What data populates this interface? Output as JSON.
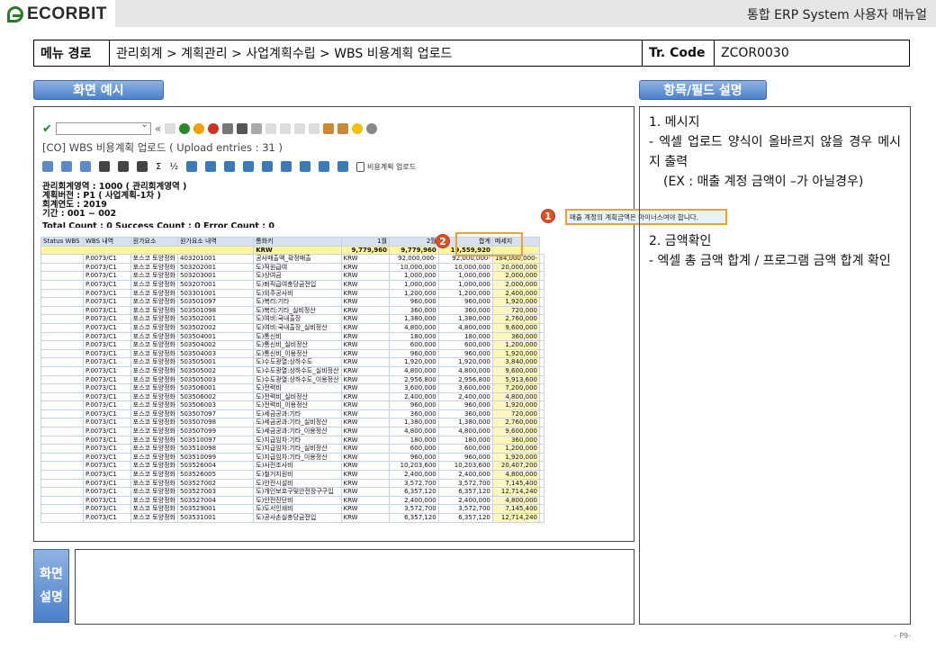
{
  "header": {
    "logo": "ECORBIT",
    "title": "통합 ERP System 사용자 매뉴얼"
  },
  "path": {
    "menu_label": "메뉴 경로",
    "menu_value": "관리회계 > 계획관리 > 사업계획수립 > WBS 비용계획 업로드",
    "tcode_label": "Tr. Code",
    "tcode_value": "ZCOR0030"
  },
  "sections": {
    "screen_example": "화면 예시",
    "field_desc": "항목/필드 설명",
    "screen_desc_1": "화면",
    "screen_desc_2": "설명"
  },
  "sap": {
    "title": "[CO] WBS 비용계획 업로드 ( Upload entries : 31 )",
    "toolbar_text": "비용계획 업로드",
    "info": [
      "관리회계영역 : 1000 (       관리회계영역 )",
      "계획버전 : P1 ( 사업계획-1차 )",
      "회계연도 : 2019",
      "기간 : 001 ~ 002"
    ],
    "count_line": "Total Count : 0 Success Count : 0 Error Count : 0",
    "message": "매출 계정의 계획금액은 마이너스여야 합니다."
  },
  "grid": {
    "headers": [
      "Status WBS",
      "WBS 내역",
      "원가요소",
      "원가요소 내역",
      "통화키",
      "1월",
      "2월",
      "합계",
      "메세지"
    ],
    "total": {
      "currency": "KRW",
      "m1": "9,779,960",
      "m2": "9,779,960",
      "sum": "19,559,920"
    },
    "rows": [
      [
        "P.0073/C1",
        "포스코 토양정화",
        "403201001",
        "공사매출액_확정매출",
        "KRW",
        "92,000,000-",
        "92,000,000-",
        "184,000,000-"
      ],
      [
        "P.0073/C1",
        "포스코 토양정화",
        "503202001",
        "도)직원급여",
        "KRW",
        "10,000,000",
        "10,000,000",
        "20,000,000"
      ],
      [
        "P.0073/C1",
        "포스코 토양정화",
        "503203001",
        "도)상여금",
        "KRW",
        "1,000,000",
        "1,000,000",
        "2,000,000"
      ],
      [
        "P.0073/C1",
        "포스코 토양정화",
        "503207001",
        "도)퇴직급여충당금전입",
        "KRW",
        "1,000,000",
        "1,000,000",
        "2,000,000"
      ],
      [
        "P.0073/C1",
        "포스코 토양정화",
        "503301001",
        "도)외주공사비",
        "KRW",
        "1,200,000",
        "1,200,000",
        "2,400,000"
      ],
      [
        "P.0073/C1",
        "포스코 토양정화",
        "503501097",
        "도)복리:기타",
        "KRW",
        "960,000",
        "960,000",
        "1,920,000"
      ],
      [
        "P.0073/C1",
        "포스코 토양정화",
        "503501098",
        "도)복리:기타_실비정산",
        "KRW",
        "360,000",
        "360,000",
        "720,000"
      ],
      [
        "P.0073/C1",
        "포스코 토양정화",
        "503502001",
        "도)여비:국내출장",
        "KRW",
        "1,380,000",
        "1,380,000",
        "2,760,000"
      ],
      [
        "P.0073/C1",
        "포스코 토양정화",
        "503502002",
        "도)여비:국내출장_실비정산",
        "KRW",
        "4,800,000",
        "4,800,000",
        "9,600,000"
      ],
      [
        "P.0073/C1",
        "포스코 토양정화",
        "503504001",
        "도)통신비",
        "KRW",
        "180,000",
        "180,000",
        "360,000"
      ],
      [
        "P.0073/C1",
        "포스코 토양정화",
        "503504002",
        "도)통신비_실비정산",
        "KRW",
        "600,000",
        "600,000",
        "1,200,000"
      ],
      [
        "P.0073/C1",
        "포스코 토양정화",
        "503504003",
        "도)통신비_이용정산",
        "KRW",
        "960,000",
        "960,000",
        "1,920,000"
      ],
      [
        "P.0073/C1",
        "포스코 토양정화",
        "503505001",
        "도)수도광열:상하수도",
        "KRW",
        "1,920,000",
        "1,920,000",
        "3,840,000"
      ],
      [
        "P.0073/C1",
        "포스코 토양정화",
        "503505002",
        "도)수도광열:상하수도_실비정산",
        "KRW",
        "4,800,000",
        "4,800,000",
        "9,600,000"
      ],
      [
        "P.0073/C1",
        "포스코 토양정화",
        "503505003",
        "도)수도광열:상하수도_이용정산",
        "KRW",
        "2,956,800",
        "2,956,800",
        "5,913,600"
      ],
      [
        "P.0073/C1",
        "포스코 토양정화",
        "503506001",
        "도)전력비",
        "KRW",
        "3,600,000",
        "3,600,000",
        "7,200,000"
      ],
      [
        "P.0073/C1",
        "포스코 토양정화",
        "503506002",
        "도)전력비_실비정산",
        "KRW",
        "2,400,000",
        "2,400,000",
        "4,800,000"
      ],
      [
        "P.0073/C1",
        "포스코 토양정화",
        "503506003",
        "도)전력비_이용정산",
        "KRW",
        "960,000",
        "960,000",
        "1,920,000"
      ],
      [
        "P.0073/C1",
        "포스코 토양정화",
        "503507097",
        "도)세금공과:기타",
        "KRW",
        "360,000",
        "360,000",
        "720,000"
      ],
      [
        "P.0073/C1",
        "포스코 토양정화",
        "503507098",
        "도)세금공과:기타_실비정산",
        "KRW",
        "1,380,000",
        "1,380,000",
        "2,760,000"
      ],
      [
        "P.0073/C1",
        "포스코 토양정화",
        "503507099",
        "도)세금공과:기타_이용정산",
        "KRW",
        "4,800,000",
        "4,800,000",
        "9,600,000"
      ],
      [
        "P.0073/C1",
        "포스코 토양정화",
        "503510097",
        "도)지급임차:기타",
        "KRW",
        "180,000",
        "180,000",
        "360,000"
      ],
      [
        "P.0073/C1",
        "포스코 토양정화",
        "503510098",
        "도)지급임차:기타_실비정산",
        "KRW",
        "600,000",
        "600,000",
        "1,200,000"
      ],
      [
        "P.0073/C1",
        "포스코 토양정화",
        "503510099",
        "도)지급임차:기타_이용정산",
        "KRW",
        "960,000",
        "960,000",
        "1,920,000"
      ],
      [
        "P.0073/C1",
        "포스코 토양정화",
        "503526004",
        "도)사전조사비",
        "KRW",
        "10,203,600",
        "10,203,600",
        "20,407,200"
      ],
      [
        "P.0073/C1",
        "포스코 토양정화",
        "503526005",
        "도)철거지원비",
        "KRW",
        "2,400,000",
        "2,400,000",
        "4,800,000"
      ],
      [
        "P.0073/C1",
        "포스코 토양정화",
        "503527002",
        "도)안전시설비",
        "KRW",
        "3,572,700",
        "3,572,700",
        "7,145,400"
      ],
      [
        "P.0073/C1",
        "포스코 토양정화",
        "503527003",
        "도)개인보호구및안전장구구입",
        "KRW",
        "6,357,120",
        "6,357,120",
        "12,714,240"
      ],
      [
        "P.0073/C1",
        "포스코 토양정화",
        "503527004",
        "도)안전진단비",
        "KRW",
        "2,400,000",
        "2,400,000",
        "4,800,000"
      ],
      [
        "P.0073/C1",
        "포스코 토양정화",
        "503529001",
        "도)도서인쇄비",
        "KRW",
        "3,572,700",
        "3,572,700",
        "7,145,400"
      ],
      [
        "P.0073/C1",
        "포스코 토양정화",
        "503531001",
        "도)공사손실충당금전입",
        "KRW",
        "6,357,120",
        "6,357,120",
        "12,714,240"
      ]
    ]
  },
  "annotations": {
    "badge1": "1",
    "badge2": "2"
  },
  "description": {
    "item1_title": "1.  메시지",
    "item1_text": " - 엑셀 업로드 양식이 올바르지 않을 경우 메시지 출력",
    "item1_example": "(EX : 매출 계정 금액이 –가 아닐경우)",
    "item2_title": "2. 금액확인",
    "item2_text": " - 엑셀 총 금액 합계 / 프로그램 금액 합계 확인"
  },
  "footer": {
    "page": "- P9-"
  }
}
